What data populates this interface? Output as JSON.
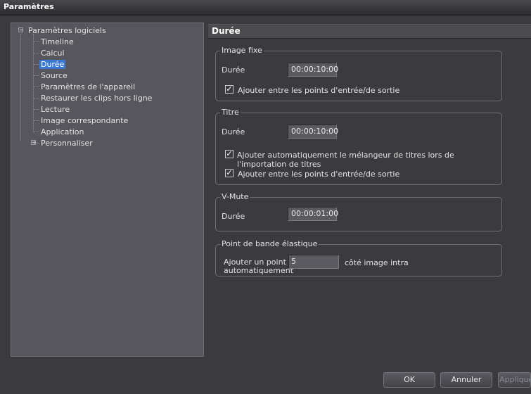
{
  "window": {
    "title": "Paramètres"
  },
  "tree": {
    "root": "Paramètres logiciels",
    "items": [
      "Timeline",
      "Calcul",
      "Durée",
      "Source",
      "Paramètres de l'appareil",
      "Restaurer les clips hors ligne",
      "Lecture",
      "Image correspondante",
      "Application"
    ],
    "selected": "Durée",
    "collapsed": "Personnaliser"
  },
  "panel": {
    "title": "Durée"
  },
  "groups": {
    "image_fixe": {
      "title": "Image fixe",
      "duration_label": "Durée",
      "duration_value": "00:00:10:00",
      "check_label": "Ajouter entre les points d'entrée/de sortie"
    },
    "titre": {
      "title": "Titre",
      "duration_label": "Durée",
      "duration_value": "00:00:10:00",
      "check1_label": "Ajouter automatiquement le mélangeur de titres lors de l'importation de titres",
      "check2_label": "Ajouter entre les points d'entrée/de sortie"
    },
    "vmute": {
      "title": "V-Mute",
      "duration_label": "Durée",
      "duration_value": "00:00:01:00"
    },
    "rubber": {
      "title": "Point de bande élastique",
      "label_line1": "Ajouter un point",
      "label_line2": "automatiquement",
      "value": "5",
      "suffix": "côté image intra"
    }
  },
  "buttons": {
    "ok": "OK",
    "cancel": "Annuler",
    "apply": "Appliquer"
  }
}
